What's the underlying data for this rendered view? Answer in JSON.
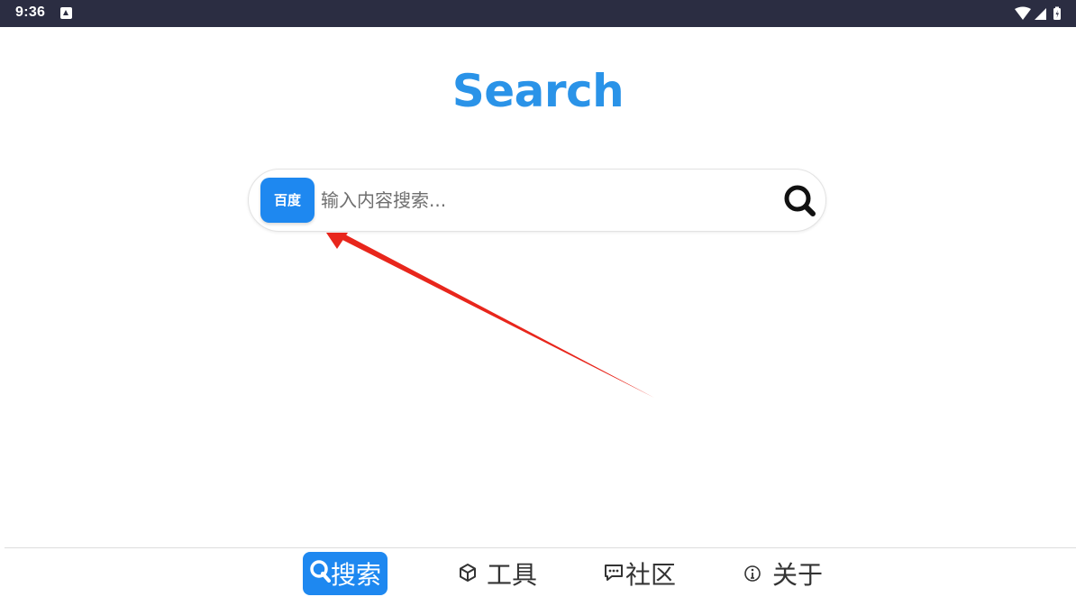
{
  "status_bar": {
    "time": "9:36"
  },
  "app": {
    "title": "Search"
  },
  "search": {
    "engine_label": "百度",
    "placeholder": "输入内容搜索..."
  },
  "nav": {
    "items": [
      {
        "label": "搜索",
        "icon": "search-icon",
        "active": true
      },
      {
        "label": "工具",
        "icon": "cube-icon",
        "active": false
      },
      {
        "label": "社区",
        "icon": "chat-icon",
        "active": false
      },
      {
        "label": "关于",
        "icon": "info-icon",
        "active": false
      }
    ]
  },
  "colors": {
    "accent": "#1e88f0",
    "title": "#2a93e8",
    "status_bar": "#2b2d42",
    "annotation": "#e8261c"
  }
}
